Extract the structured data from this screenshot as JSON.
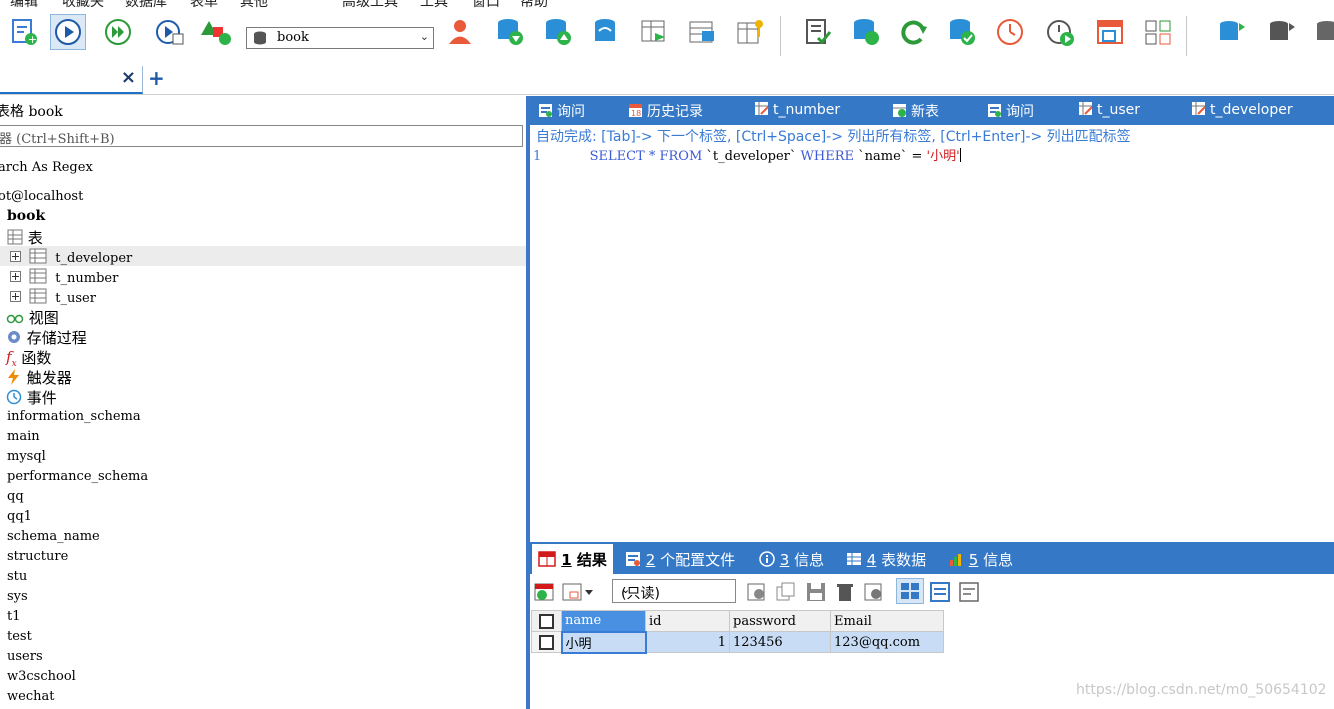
{
  "menubar": {
    "items": [
      "编辑",
      "收藏夹",
      "数据库",
      "表单",
      "其他",
      "高级工具",
      "工具",
      "窗口",
      "帮助"
    ]
  },
  "toolbar": {
    "database_select": "book",
    "icons": [
      "new-query-icon",
      "execute-icon",
      "execute-all-icon",
      "execute-to-grid-icon",
      "shapes-icon",
      "user-manager-icon",
      "database-backup-icon",
      "database-restore-icon",
      "database-sync-icon",
      "table-schema-icon",
      "table-copy-icon",
      "table-key-icon",
      "query-log-icon",
      "database-refresh-icon",
      "refresh-icon",
      "database-check-icon",
      "scheduler-icon",
      "run-event-icon",
      "table-layout-icon",
      "table-compare-icon",
      "db-sync-icon",
      "db-migrate-icon",
      "db-more-icon"
    ]
  },
  "object_tab": {
    "close": "×",
    "add": "+"
  },
  "tree": {
    "header": "表格 book",
    "filter_placeholder": "器 (Ctrl+Shift+B)",
    "search_regex": "arch As Regex",
    "connection": "ot@localhost",
    "database": "book",
    "tables_folder": "表",
    "tables": [
      "t_developer",
      "t_number",
      "t_user"
    ],
    "views": "视图",
    "procedures": "存储过程",
    "functions": "函数",
    "triggers": "触发器",
    "events": "事件",
    "other_databases": [
      "information_schema",
      "main",
      "mysql",
      "performance_schema",
      "qq",
      "qq1",
      "schema_name",
      "structure",
      "stu",
      "sys",
      "t1",
      "test",
      "users",
      "w3cschool",
      "wechat"
    ]
  },
  "query_tabs": [
    {
      "label": "询问",
      "icon": "query-icon"
    },
    {
      "label": "历史记录",
      "icon": "history-icon"
    },
    {
      "label": "t_number",
      "icon": "table-edit-icon"
    },
    {
      "label": "新表",
      "icon": "new-table-icon"
    },
    {
      "label": "询问",
      "icon": "query-icon"
    },
    {
      "label": "t_user",
      "icon": "table-edit-icon"
    },
    {
      "label": "t_developer",
      "icon": "table-edit-icon"
    }
  ],
  "editor": {
    "hint": "自动完成: [Tab]-> 下一个标签, [Ctrl+Space]-> 列出所有标签, [Ctrl+Enter]-> 列出匹配标签",
    "line_number": "1",
    "sql": {
      "kw_select": "SELECT",
      "star": "*",
      "kw_from": "FROM",
      "table": "`t_developer`",
      "kw_where": "WHERE",
      "column": "`name`",
      "op": "=",
      "value": "'小明'"
    }
  },
  "result_tabs": [
    {
      "num": "1",
      "label": "结果",
      "active": true
    },
    {
      "num": "2",
      "label": "个配置文件"
    },
    {
      "num": "3",
      "label": "信息"
    },
    {
      "num": "4",
      "label": "表数据"
    },
    {
      "num": "5",
      "label": "信息"
    }
  ],
  "result_toolbar": {
    "mode": "(只读)"
  },
  "grid": {
    "columns": [
      "name",
      "id",
      "password",
      "Email"
    ],
    "rows": [
      [
        "小明",
        "1",
        "123456",
        "123@qq.com"
      ]
    ]
  },
  "watermark": "https://blog.csdn.net/m0_50654102"
}
